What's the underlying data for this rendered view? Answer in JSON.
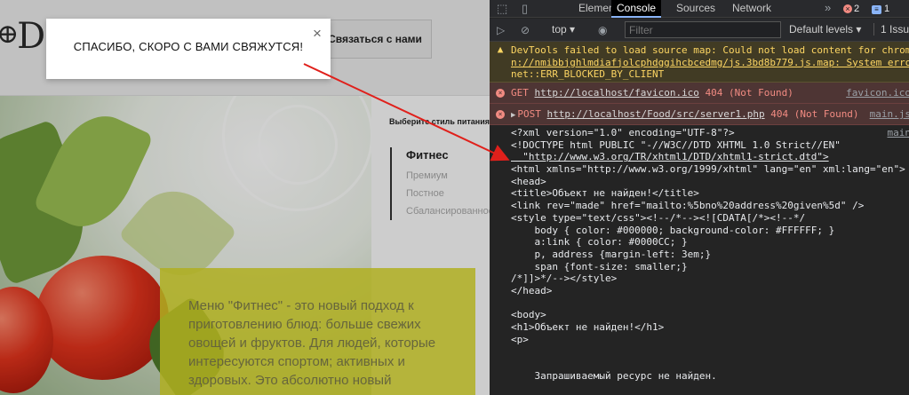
{
  "site": {
    "logo_text": "D",
    "contact_button": "Связаться с нами",
    "style_title": "Выберите стиль питания",
    "menu": [
      {
        "label": "Фитнес",
        "active": true
      },
      {
        "label": "Премиум",
        "active": false
      },
      {
        "label": "Постное",
        "active": false
      },
      {
        "label": "Сбалансированное",
        "active": false
      }
    ],
    "description": "Меню \"Фитнес\" - это новый подход к приготовлению блюд: больше свежих овощей и фруктов. Для людей, которые интересуются спортом; активных и здоровых. Это абсолютно новый",
    "accent_color": "#d7d628"
  },
  "modal": {
    "message": "СПАСИБО, СКОРО С ВАМИ СВЯЖУТСЯ!",
    "close": "×"
  },
  "devtools": {
    "tabs": [
      "Elements",
      "Console",
      "Sources",
      "Network"
    ],
    "active_tab": "Console",
    "error_count": "2",
    "message_count": "1",
    "context": "top",
    "filter_placeholder": "Filter",
    "levels": "Default levels",
    "issues": "1 Issue",
    "messages": [
      {
        "type": "warning",
        "lines": [
          "DevTools failed to load source map: Could not load content for chrome-extension://",
          "n://nmibbjghlmdiafjolcphdggihcbcedmg/js.3bd8b779.js.map: System error:",
          "net::ERR_BLOCKED_BY_CLIENT"
        ]
      },
      {
        "type": "error",
        "method": "GET",
        "url": "http://localhost/favicon.ico",
        "status": "404 (Not Found)",
        "source": "favicon.ico"
      },
      {
        "type": "error",
        "method": "POST",
        "url": "http://localhost/Food/src/server1.php",
        "status": "404 (Not Found)",
        "source": "main.js"
      }
    ],
    "log_source": "main",
    "xml_lines": [
      "<?xml version=\"1.0\" encoding=\"UTF-8\"?>",
      "<!DOCTYPE html PUBLIC \"-//W3C//DTD XHTML 1.0 Strict//EN\"",
      "  \"http://www.w3.org/TR/xhtml1/DTD/xhtml1-strict.dtd\">",
      "<html xmlns=\"http://www.w3.org/1999/xhtml\" lang=\"en\" xml:lang=\"en\">",
      "<head>",
      "<title>Объект не найден!</title>",
      "<link rev=\"made\" href=\"mailto:%5bno%20address%20given%5d\" />",
      "<style type=\"text/css\"><!--/*--><![CDATA[/*><!--*/",
      "    body { color: #000000; background-color: #FFFFFF; }",
      "    a:link { color: #0000CC; }",
      "    p, address {margin-left: 3em;}",
      "    span {font-size: smaller;}",
      "/*]]>*/--></style>",
      "</head>",
      "",
      "<body>",
      "<h1>Объект не найден!</h1>",
      "<p>",
      "",
      "",
      "    Запрашиваемый ресурс не найден."
    ]
  }
}
